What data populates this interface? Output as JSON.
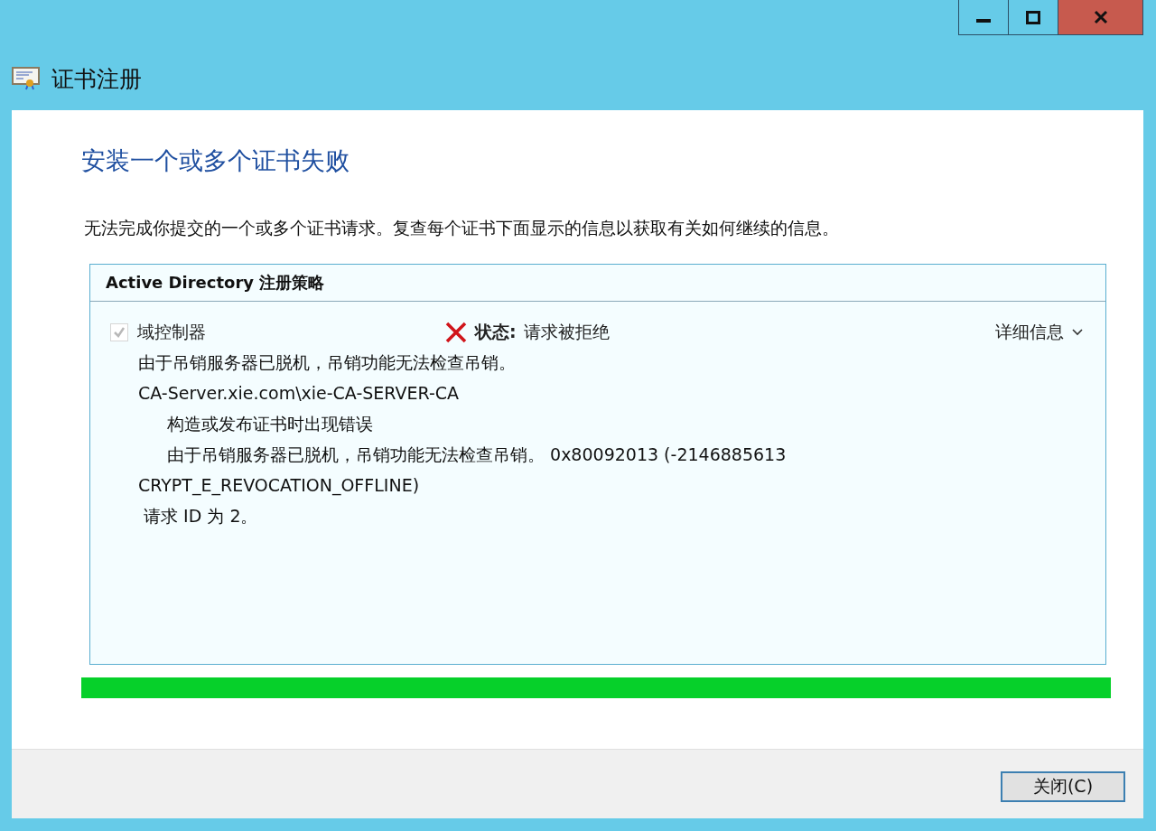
{
  "window": {
    "title": "证书注册"
  },
  "heading": "安装一个或多个证书失败",
  "description": "无法完成你提交的一个或多个证书请求。复查每个证书下面显示的信息以获取有关如何继续的信息。",
  "policy": {
    "title": "Active Directory 注册策略",
    "items": [
      {
        "name": "域控制器",
        "checked": true,
        "disabled": true,
        "status_label": "状态:",
        "status": "请求被拒绝",
        "details_link": "详细信息",
        "lines": [
          {
            "text": "由于吊销服务器已脱机，吊销功能无法检查吊销。"
          },
          {
            "text": "CA-Server.xie.com\\xie-CA-SERVER-CA",
            "children": [
              {
                "text": "构造或发布证书时出现错误"
              },
              {
                "text": "由于吊销服务器已脱机，吊销功能无法检查吊销。 0x80092013 (-2146885613"
              }
            ]
          },
          {
            "text": "CRYPT_E_REVOCATION_OFFLINE)"
          },
          {
            "text": " 请求 ID 为 2。"
          }
        ]
      }
    ]
  },
  "progress": {
    "level": 1.0
  },
  "buttons": [
    {
      "label": "关闭(C)"
    }
  ]
}
